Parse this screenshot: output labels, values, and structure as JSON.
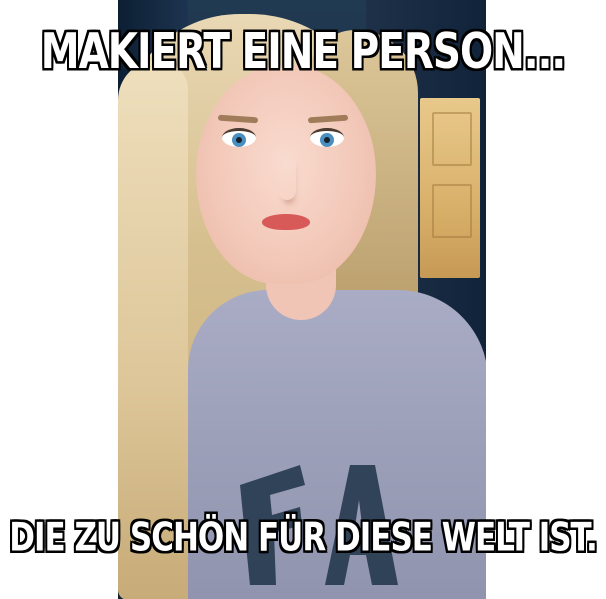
{
  "meme": {
    "top_text": "MAKIERT EINE PERSON...",
    "bottom_text": "DIE ZU SCHÖN FÜR DIESE WELT IST."
  },
  "colors": {
    "background": "#ffffff",
    "caption_fill": "#ffffff",
    "caption_outline": "#000000",
    "shirt": "#a9acc4",
    "shirt_print": "#1f3448",
    "hair": "#e2cfa6",
    "eyes": "#4a8fbf",
    "lips": "#d85a58"
  }
}
